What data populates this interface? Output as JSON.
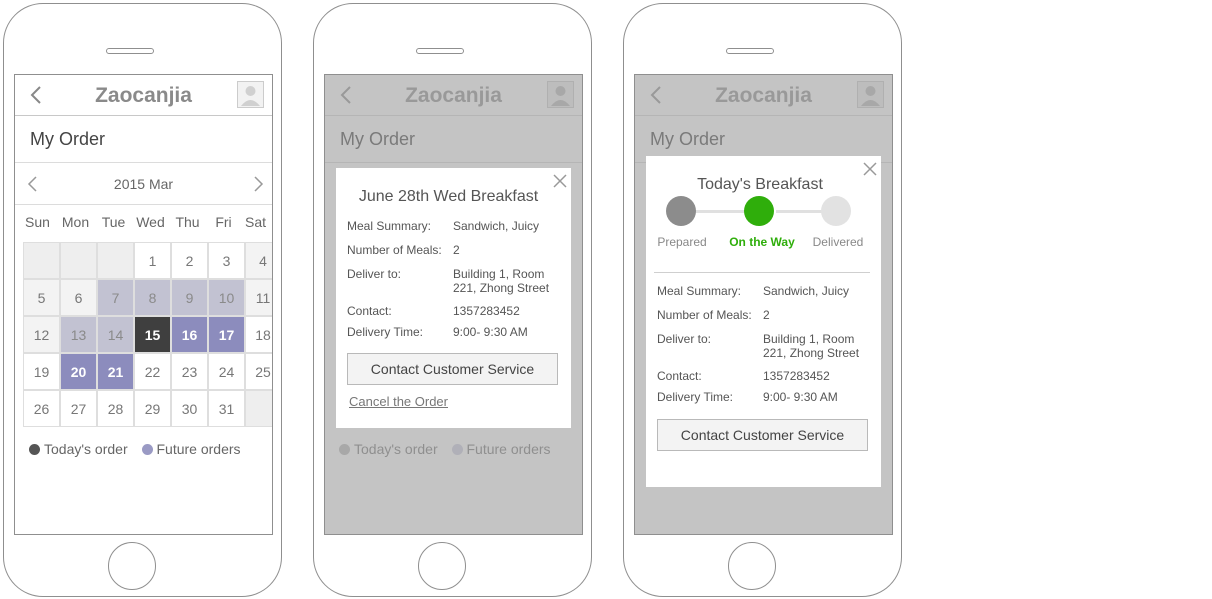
{
  "app": {
    "title": "Zaocanjia"
  },
  "page": {
    "title": "My Order"
  },
  "calendar": {
    "month_label": "2015 Mar",
    "weekdays": [
      "Sun",
      "Mon",
      "Tue",
      "Wed",
      "Thu",
      "Fri",
      "Sat"
    ],
    "weeks": [
      [
        "",
        "",
        "",
        "1",
        "2",
        "3",
        "4"
      ],
      [
        "5",
        "6",
        "7",
        "8",
        "9",
        "10",
        "11"
      ],
      [
        "12",
        "13",
        "14",
        "15",
        "16",
        "17",
        "18"
      ],
      [
        "19",
        "20",
        "21",
        "22",
        "23",
        "24",
        "25"
      ],
      [
        "26",
        "27",
        "28",
        "29",
        "30",
        "31",
        ""
      ]
    ],
    "today": "15",
    "future_orders": [
      "16",
      "17",
      "20",
      "21"
    ]
  },
  "legend": {
    "today": "Today's order",
    "future": "Future orders"
  },
  "colors": {
    "today": "#3f3f3f",
    "future": "#8c8cbd",
    "on_the_way": "#2fae0b",
    "prepared": "#8c8c8c"
  },
  "order_modal": {
    "title": "June 28th Wed Breakfast",
    "rows": [
      {
        "key": "Meal Summary:",
        "value": "Sandwich, Juicy"
      },
      {
        "key": "Number of Meals:",
        "value": "2"
      },
      {
        "key": "Deliver to:",
        "value": "Building 1, Room 221, Zhong Street"
      },
      {
        "key": "Contact:",
        "value": "1357283452"
      },
      {
        "key": "Delivery Time:",
        "value": "9:00- 9:30 AM"
      }
    ],
    "contact_button": "Contact Customer Service",
    "cancel_link": "Cancel the Order"
  },
  "today_modal": {
    "title": "Today's Breakfast",
    "steps": [
      {
        "label": "Prepared",
        "state": "done"
      },
      {
        "label": "On the Way",
        "state": "active"
      },
      {
        "label": "Delivered",
        "state": "pending"
      }
    ],
    "rows": [
      {
        "key": "Meal Summary:",
        "value": "Sandwich, Juicy"
      },
      {
        "key": "Number of Meals:",
        "value": "2"
      },
      {
        "key": "Deliver to:",
        "value": "Building 1, Room 221, Zhong Street"
      },
      {
        "key": "Contact:",
        "value": "1357283452"
      },
      {
        "key": "Delivery Time:",
        "value": "9:00- 9:30 AM"
      }
    ],
    "contact_button": "Contact Customer Service"
  },
  "icons": {
    "back": "chevron-left-icon",
    "avatar": "user-avatar-icon",
    "prev": "chevron-left-icon",
    "next": "chevron-right-icon",
    "close": "close-icon"
  }
}
